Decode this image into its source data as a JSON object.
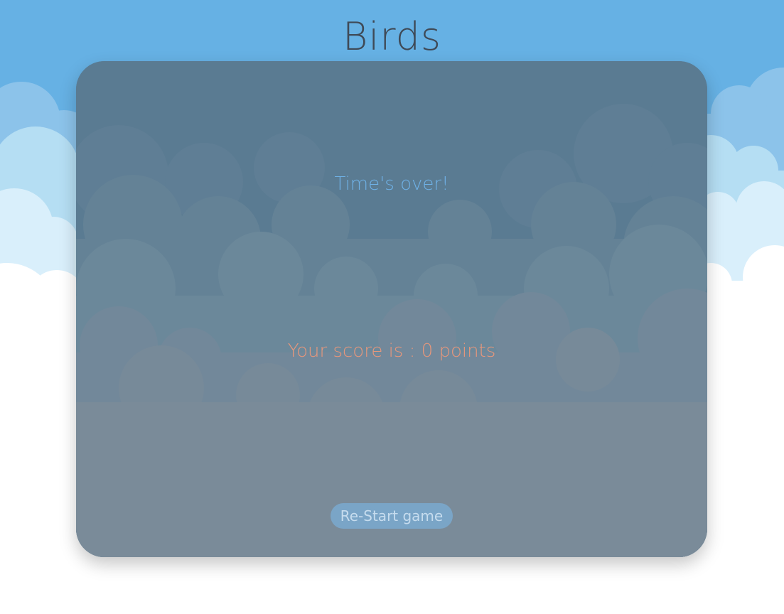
{
  "game": {
    "title": "Birds"
  },
  "result_panel": {
    "message": "Time's over!",
    "score_text": "Your score is : 0 points",
    "score": 0,
    "restart_label": "Re-Start game"
  },
  "colors": {
    "sky": "#66b1e4",
    "title": "#3f4a57",
    "message": "#6fb1e6",
    "score": "#e8977b",
    "button": "#7aa5c7",
    "button_text": "#c6dcee"
  }
}
